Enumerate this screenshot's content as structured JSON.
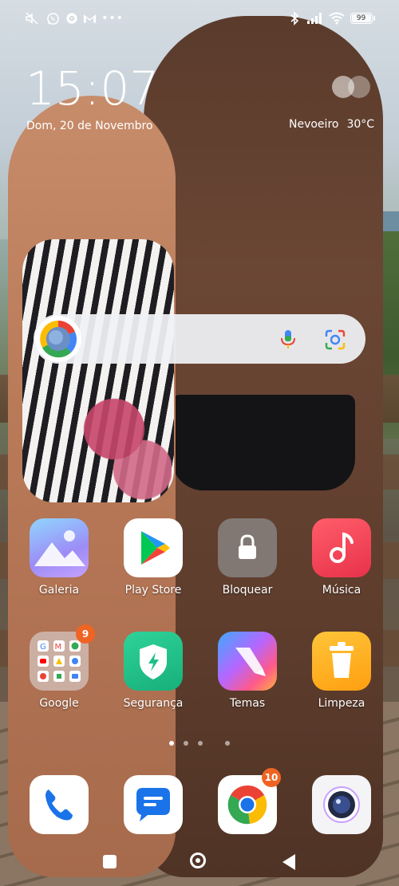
{
  "status_bar": {
    "battery": "99",
    "left_icons": [
      "mute-icon",
      "whatsapp-icon",
      "chrome-icon",
      "gmail-icon",
      "more-notifications-icon"
    ],
    "right_icons": [
      "bluetooth-icon",
      "signal-icon",
      "wifi-icon",
      "battery-icon"
    ]
  },
  "lockscreen": {
    "time": "15:07",
    "date": "Dom, 20 de Novembro",
    "weather_condition": "Nevoeiro",
    "temperature": "30°C"
  },
  "apps_row1": [
    {
      "label": "Galeria",
      "icon": "gallery-icon"
    },
    {
      "label": "Play Store",
      "icon": "play-store-icon"
    },
    {
      "label": "Bloquear",
      "icon": "lock-icon"
    },
    {
      "label": "Música",
      "icon": "music-icon"
    }
  ],
  "apps_row2": [
    {
      "label": "Google",
      "icon": "google-folder-icon",
      "badge": "9"
    },
    {
      "label": "Segurança",
      "icon": "security-icon"
    },
    {
      "label": "Temas",
      "icon": "themes-icon"
    },
    {
      "label": "Limpeza",
      "icon": "cleaner-icon"
    }
  ],
  "dock": [
    {
      "icon": "phone-icon"
    },
    {
      "icon": "messages-icon"
    },
    {
      "icon": "chrome-icon",
      "badge": "10"
    },
    {
      "icon": "camera-icon"
    }
  ],
  "colors": {
    "badge": "#f06423",
    "play_green": "#00c853",
    "music_red": "#ef3f4a",
    "security_green": "#1fbf8a",
    "cleaner_yellow": "#ffb019"
  }
}
